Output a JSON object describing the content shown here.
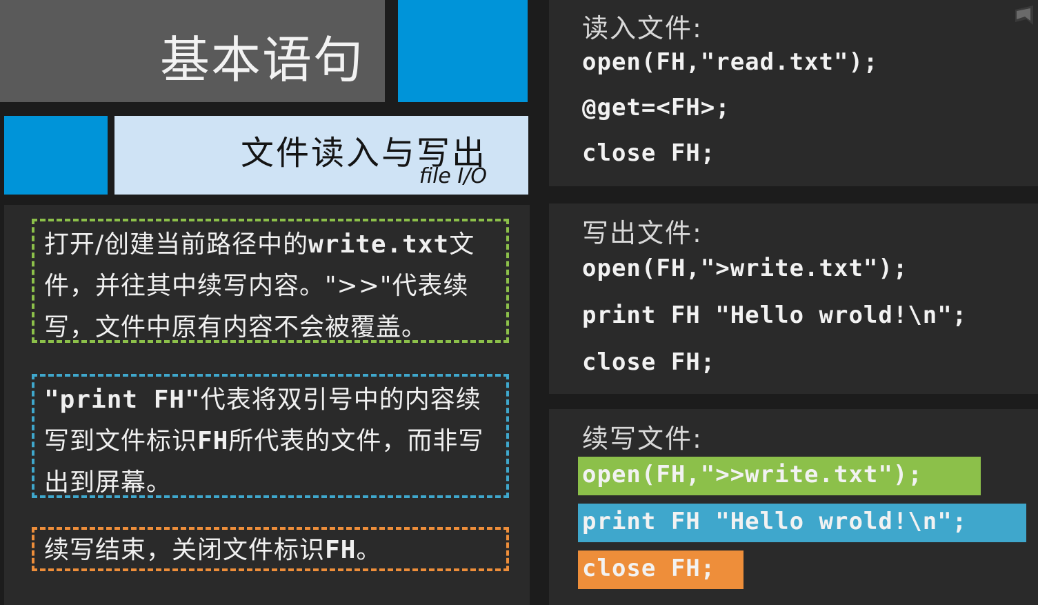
{
  "header": {
    "title": "基本语句",
    "subtitle": "文件读入与写出",
    "subtitle_en": "file I/O"
  },
  "notes": {
    "green": {
      "pre": "打开/创建当前路径中的",
      "code": "write.txt",
      "post": "文件，并往其中续写内容。\">>\"代表续写，文件中原有内容不会被覆盖。"
    },
    "blue": {
      "code1": "\"print FH\"",
      "mid": "代表将双引号中的内容续写到文件标识",
      "code2": "FH",
      "post": "所代表的文件，而非写出到屏幕。"
    },
    "orange": {
      "pre": "续写结束，关闭文件标识",
      "code": "FH",
      "post": "。"
    }
  },
  "read_panel": {
    "heading": "读入文件:",
    "lines": [
      "open(FH,\"read.txt\");",
      "@get=<FH>;",
      "close FH;"
    ]
  },
  "write_panel": {
    "heading": "写出文件:",
    "lines": [
      "open(FH,\">write.txt\");",
      "print FH \"Hello wrold!\\n\";",
      "close FH;"
    ]
  },
  "append_panel": {
    "heading": "续写文件:",
    "lines": [
      "open(FH,\">>write.txt\");",
      "print FH \"Hello wrold!\\n\";",
      "close FH;"
    ]
  },
  "colors": {
    "green": "#8cc04a",
    "blue": "#3fa7cc",
    "orange": "#ee8e3a",
    "accent_blue": "#0094d9"
  }
}
